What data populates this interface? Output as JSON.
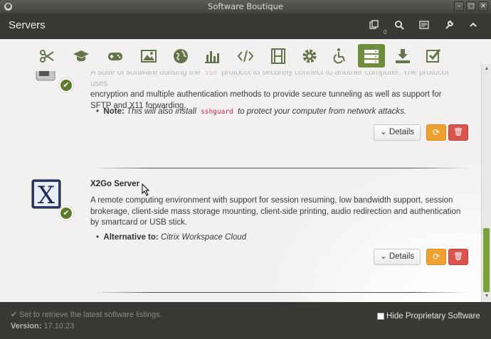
{
  "window": {
    "title": "Software Boutique"
  },
  "header": {
    "title": "Servers",
    "queue_count": "0"
  },
  "categories": [
    {
      "name": "accessories-icon"
    },
    {
      "name": "education-icon"
    },
    {
      "name": "games-icon"
    },
    {
      "name": "graphics-icon"
    },
    {
      "name": "internet-icon"
    },
    {
      "name": "office-icon"
    },
    {
      "name": "programming-icon"
    },
    {
      "name": "multimedia-icon"
    },
    {
      "name": "system-icon"
    },
    {
      "name": "accessibility-icon"
    },
    {
      "name": "servers-icon",
      "active": true
    },
    {
      "name": "downloads-icon"
    },
    {
      "name": "installed-icon"
    }
  ],
  "items": [
    {
      "desc_faded_prefix": "A suite of software utilising the ",
      "desc_code": "ssh",
      "desc_faded_suffix": " protocol to securely connect to another computer. The protocol uses",
      "desc_rest": "encryption and multiple authentication methods to provide secure tunneling as well as support for SFTP and X11 forwarding.",
      "note_label": "Note:",
      "note_text_1": "This will also install ",
      "note_code": "sshguard",
      "note_text_2": " to protect your computer from network attacks.",
      "details_label": "Details"
    },
    {
      "name": "X2Go Server",
      "desc": "A remote computing environment with support for session resuming, low bandwidth support, session brokerage, client-side mass storage mounting, client-side printing, audio redirection and authentication by smartcard or USB stick.",
      "alt_label": "Alternative to:",
      "alt_value": "Citrix Workspace Cloud",
      "details_label": "Details"
    }
  ],
  "footer": {
    "status": "Set to retrieve the latest software listings.",
    "version_label": "Version:",
    "version_value": "17.10.23",
    "hide_proprietary": "Hide Proprietary Software"
  },
  "colors": {
    "accent": "#6e8d3a",
    "sync": "#f0a030",
    "remove": "#d9534f",
    "header": "#393835"
  }
}
